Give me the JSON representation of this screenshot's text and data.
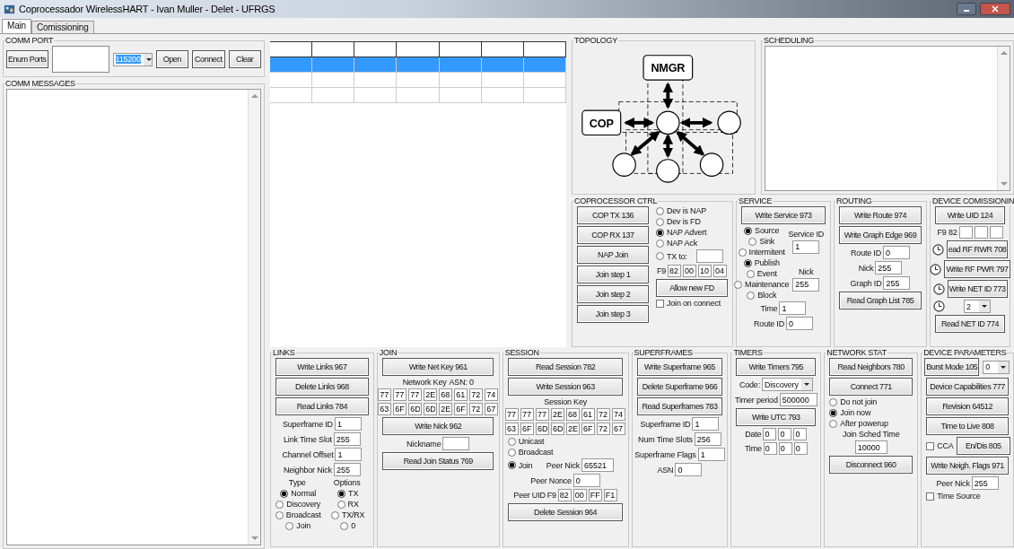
{
  "window": {
    "title": "Coprocessador WirelessHART - Ivan Muller - Delet - UFRGS"
  },
  "tabs": [
    {
      "label": "Main",
      "selected": true
    },
    {
      "label": "Comissioning",
      "selected": false
    }
  ],
  "comm_port": {
    "title": "COMM PORT",
    "enum_button": "Enum Ports",
    "baud": "115200",
    "buttons": [
      "Open",
      "Connect",
      "Clear"
    ]
  },
  "comm_messages": {
    "title": "COMM MESSAGES"
  },
  "grid": {
    "rows": [
      {
        "selected": true
      },
      {
        "selected": false
      },
      {
        "selected": false
      }
    ]
  },
  "topology": {
    "title": "TOPOLOGY",
    "manager_label": "NMGR",
    "coprocessor_label": "COP"
  },
  "scheduling": {
    "title": "SCHEDULING"
  },
  "middle_groups": [
    {
      "title": "COPROCESSOR CTRL",
      "columns": [
        [
          {
            "kind": "button",
            "label": "COP TX 136"
          },
          {
            "kind": "button",
            "label": "COP RX 137"
          },
          {
            "kind": "button",
            "label": "NAP Join"
          },
          {
            "kind": "button",
            "label": "Join step 1"
          },
          {
            "kind": "button",
            "label": "Join step 2"
          },
          {
            "kind": "button",
            "label": "Join step 3"
          }
        ],
        [
          {
            "kind": "radio",
            "label": "Dev is NAP",
            "selected": false
          },
          {
            "kind": "radio",
            "label": "Dev is FD",
            "selected": false
          },
          {
            "kind": "radio",
            "label": "NAP Advert",
            "selected": true
          },
          {
            "kind": "radio",
            "label": "NAP Ack",
            "selected": false
          },
          {
            "kind": "row",
            "items": [
              {
                "kind": "radio",
                "label": "TX to:",
                "selected": false
              },
              {
                "kind": "field"
              }
            ]
          },
          {
            "kind": "hex",
            "prefix": "F9",
            "values": [
              "82",
              "00",
              "10",
              "04"
            ]
          },
          {
            "kind": "button",
            "label": "Allow new FD"
          },
          {
            "kind": "check",
            "label": "Join on connect",
            "checked": false
          }
        ]
      ]
    },
    {
      "title": "SERVICE",
      "columns": [
        [
          {
            "kind": "button",
            "label": "Write Service 973"
          },
          {
            "kind": "row",
            "items": [
              {
                "kind": "col",
                "items": [
                  {
                    "kind": "radio",
                    "label": "Source",
                    "selected": true
                  },
                  {
                    "kind": "radio",
                    "label": "Sink",
                    "selected": false
                  },
                  {
                    "kind": "radio",
                    "label": "Intermitent",
                    "selected": false
                  }
                ]
              },
              {
                "kind": "col",
                "items": [
                  {
                    "kind": "text",
                    "text": "Service ID"
                  },
                  {
                    "kind": "field",
                    "value": "1"
                  }
                ]
              }
            ]
          },
          {
            "kind": "row",
            "items": [
              {
                "kind": "col",
                "items": [
                  {
                    "kind": "radio",
                    "label": "Publish",
                    "selected": true
                  },
                  {
                    "kind": "radio",
                    "label": "Event",
                    "selected": false
                  },
                  {
                    "kind": "radio",
                    "label": "Maintenance",
                    "selected": false
                  },
                  {
                    "kind": "radio",
                    "label": "Block",
                    "selected": false
                  }
                ]
              },
              {
                "kind": "col",
                "items": [
                  {
                    "kind": "text",
                    "text": "Nick"
                  },
                  {
                    "kind": "field",
                    "value": "255"
                  }
                ]
              }
            ]
          },
          {
            "kind": "field",
            "label": "Time",
            "value": "1"
          },
          {
            "kind": "field",
            "label": "Route ID",
            "value": "0"
          }
        ]
      ]
    },
    {
      "title": "ROUTING",
      "columns": [
        [
          {
            "kind": "button",
            "label": "Write Route 974"
          },
          {
            "kind": "button",
            "label": "Write Graph Edge 969"
          },
          {
            "kind": "field",
            "label": "Route ID",
            "value": "0"
          },
          {
            "kind": "field",
            "label": "Nick",
            "value": "255"
          },
          {
            "kind": "field",
            "label": "Graph ID",
            "value": "255"
          },
          {
            "kind": "button",
            "label": "Read Graph List 785"
          }
        ]
      ]
    },
    {
      "title": "DEVICE COMISSIONIN",
      "columns": [
        [
          {
            "kind": "button",
            "label": "Write UID 124"
          },
          {
            "kind": "hex",
            "prefix": "F9 82"
          },
          {
            "kind": "row",
            "items": [
              {
                "kind": "clock"
              },
              {
                "kind": "button",
                "label": "ead RF RWR 708"
              }
            ]
          },
          {
            "kind": "row",
            "items": [
              {
                "kind": "clock"
              },
              {
                "kind": "button",
                "label": "Write RF PWR 797"
              }
            ]
          },
          {
            "kind": "row",
            "items": [
              {
                "kind": "clock"
              },
              {
                "kind": "button",
                "label": "Write NET ID 773"
              }
            ]
          },
          {
            "kind": "row",
            "items": [
              {
                "kind": "clock"
              },
              {
                "kind": "select",
                "value": "2"
              }
            ]
          },
          {
            "kind": "button",
            "label": "Read NET ID 774"
          }
        ]
      ]
    }
  ],
  "bottom_groups": [
    {
      "title": "LINKS",
      "columns": [
        [
          {
            "kind": "button",
            "label": "Write Links 967"
          },
          {
            "kind": "button",
            "label": "Delete Links 968"
          },
          {
            "kind": "button",
            "label": "Read Links 784"
          },
          {
            "kind": "field",
            "label": "Superframe ID",
            "value": "1"
          },
          {
            "kind": "field",
            "label": "Link Time Slot",
            "value": "255"
          },
          {
            "kind": "field",
            "label": "Channel Offset",
            "value": "1"
          },
          {
            "kind": "field",
            "label": "Neighbor Nick",
            "value": "255"
          },
          {
            "kind": "row",
            "items": [
              {
                "kind": "col",
                "items": [
                  {
                    "kind": "text",
                    "text": "Type"
                  },
                  {
                    "kind": "radio",
                    "label": "Normal",
                    "selected": true
                  },
                  {
                    "kind": "radio",
                    "label": "Discovery",
                    "selected": false
                  },
                  {
                    "kind": "radio",
                    "label": "Broadcast",
                    "selected": false
                  },
                  {
                    "kind": "radio",
                    "label": "Join",
                    "selected": false
                  }
                ]
              },
              {
                "kind": "col",
                "items": [
                  {
                    "kind": "text",
                    "text": "Options"
                  },
                  {
                    "kind": "radio",
                    "label": "TX",
                    "selected": true
                  },
                  {
                    "kind": "radio",
                    "label": "RX",
                    "selected": false
                  },
                  {
                    "kind": "radio",
                    "label": "TX/RX",
                    "selected": false
                  },
                  {
                    "kind": "radio",
                    "label": "0",
                    "selected": false
                  }
                ]
              }
            ]
          }
        ]
      ]
    },
    {
      "title": "JOIN",
      "columns": [
        [
          {
            "kind": "button",
            "label": "Write Net Key 961"
          },
          {
            "kind": "row",
            "items": [
              {
                "kind": "text",
                "text": "Network Key"
              },
              {
                "kind": "text",
                "text": "ASN: 0"
              }
            ]
          },
          {
            "kind": "hex",
            "values": [
              "77",
              "77",
              "77",
              "2E",
              "68",
              "61",
              "72",
              "74"
            ]
          },
          {
            "kind": "hex",
            "values": [
              "63",
              "6F",
              "6D",
              "6D",
              "2E",
              "6F",
              "72",
              "67"
            ]
          },
          {
            "kind": "button",
            "label": "Write Nick 962"
          },
          {
            "kind": "field",
            "label": "Nickname"
          },
          {
            "kind": "button",
            "label": "Read Join Status 769"
          }
        ]
      ]
    },
    {
      "title": "SESSION",
      "columns": [
        [
          {
            "kind": "button",
            "label": "Read Session 782"
          },
          {
            "kind": "button",
            "label": "Write Session 963"
          },
          {
            "kind": "text",
            "text": "Session Key"
          },
          {
            "kind": "hex",
            "values": [
              "77",
              "77",
              "77",
              "2E",
              "68",
              "61",
              "72",
              "74"
            ]
          },
          {
            "kind": "hex",
            "values": [
              "63",
              "6F",
              "6D",
              "6D",
              "2E",
              "6F",
              "72",
              "67"
            ]
          },
          {
            "kind": "radio",
            "label": "Unicast",
            "selected": false
          },
          {
            "kind": "radio",
            "label": "Broadcast",
            "selected": false
          },
          {
            "kind": "row",
            "items": [
              {
                "kind": "radio",
                "label": "Join",
                "selected": true
              },
              {
                "kind": "field",
                "label": "Peer Nick",
                "value": "65521"
              }
            ]
          },
          {
            "kind": "field",
            "label": "Peer Nonce",
            "value": "0"
          },
          {
            "kind": "hex",
            "label": "Peer UID",
            "prefix": "F9",
            "values": [
              "82",
              "00",
              "FF",
              "F1"
            ]
          },
          {
            "kind": "button",
            "label": "Delete Session 964"
          }
        ]
      ]
    },
    {
      "title": "SUPERFRAMES",
      "columns": [
        [
          {
            "kind": "button",
            "label": "Write Superframe 965"
          },
          {
            "kind": "button",
            "label": "Delete Superframe 966"
          },
          {
            "kind": "button",
            "label": "Read Superframes 783"
          },
          {
            "kind": "field",
            "label": "Superframe ID",
            "value": "1"
          },
          {
            "kind": "field",
            "label": "Num Time Slots",
            "value": "256"
          },
          {
            "kind": "field",
            "label": "Superframe Flags",
            "value": "1"
          },
          {
            "kind": "field",
            "label": "ASN",
            "value": "0"
          }
        ]
      ]
    },
    {
      "title": "TIMERS",
      "columns": [
        [
          {
            "kind": "button",
            "label": "Write Timers 795"
          },
          {
            "kind": "select",
            "label": "Code:",
            "value": "Discovery"
          },
          {
            "kind": "field",
            "label": "Timer period",
            "value": "500000"
          },
          {
            "kind": "button",
            "label": "Write UTC 793"
          },
          {
            "kind": "hex",
            "label": "Date",
            "values": [
              "0",
              "0",
              "0"
            ]
          },
          {
            "kind": "hex",
            "label": "Time",
            "values": [
              "0",
              "0",
              "0"
            ]
          }
        ]
      ]
    },
    {
      "title": "NETWORK STAT",
      "columns": [
        [
          {
            "kind": "button",
            "label": "Read Neighbors 780"
          },
          {
            "kind": "button",
            "label": "Connect 771"
          },
          {
            "kind": "radio",
            "label": "Do not join",
            "selected": false
          },
          {
            "kind": "radio",
            "label": "Join now",
            "selected": true
          },
          {
            "kind": "radio",
            "label": "After powerup",
            "selected": false
          },
          {
            "kind": "text",
            "text": "Join Sched Time"
          },
          {
            "kind": "field",
            "value": "10000"
          },
          {
            "kind": "button",
            "label": "Disconnect 960"
          }
        ]
      ]
    },
    {
      "title": "DEVICE PARAMETERS",
      "columns": [
        [
          {
            "kind": "row",
            "items": [
              {
                "kind": "button",
                "label": "Burst Mode 105"
              },
              {
                "kind": "select",
                "value": "0"
              }
            ]
          },
          {
            "kind": "button",
            "label": "Device Capabilities 777"
          },
          {
            "kind": "button",
            "label": "Revision 64512"
          },
          {
            "kind": "button",
            "label": "Time to Live 808"
          },
          {
            "kind": "row",
            "items": [
              {
                "kind": "check",
                "label": "CCA",
                "checked": false
              },
              {
                "kind": "button",
                "label": "En/Dis 805"
              }
            ]
          },
          {
            "kind": "button",
            "label": "Write Neigh. Flags 971"
          },
          {
            "kind": "field",
            "label": "Peer Nick",
            "value": "255"
          },
          {
            "kind": "check",
            "label": "Time Source",
            "checked": false
          }
        ]
      ]
    }
  ]
}
